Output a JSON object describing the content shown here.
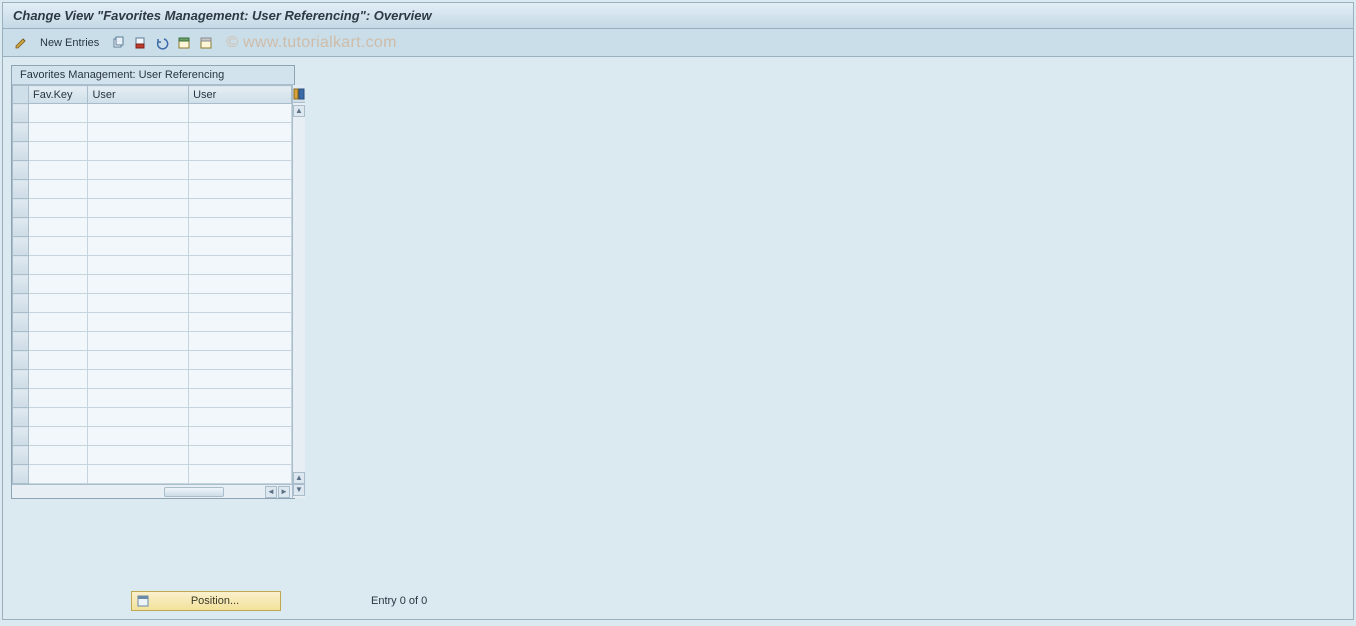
{
  "title": "Change View \"Favorites Management: User Referencing\": Overview",
  "toolbar": {
    "new_entries_label": "New Entries"
  },
  "watermark": "© www.tutorialkart.com",
  "table": {
    "caption": "Favorites Management: User Referencing",
    "columns": [
      "Fav.Key",
      "User",
      "User"
    ],
    "rows": [
      {
        "favkey": "",
        "user1": "",
        "user2": ""
      },
      {
        "favkey": "",
        "user1": "",
        "user2": ""
      },
      {
        "favkey": "",
        "user1": "",
        "user2": ""
      },
      {
        "favkey": "",
        "user1": "",
        "user2": ""
      },
      {
        "favkey": "",
        "user1": "",
        "user2": ""
      },
      {
        "favkey": "",
        "user1": "",
        "user2": ""
      },
      {
        "favkey": "",
        "user1": "",
        "user2": ""
      },
      {
        "favkey": "",
        "user1": "",
        "user2": ""
      },
      {
        "favkey": "",
        "user1": "",
        "user2": ""
      },
      {
        "favkey": "",
        "user1": "",
        "user2": ""
      },
      {
        "favkey": "",
        "user1": "",
        "user2": ""
      },
      {
        "favkey": "",
        "user1": "",
        "user2": ""
      },
      {
        "favkey": "",
        "user1": "",
        "user2": ""
      },
      {
        "favkey": "",
        "user1": "",
        "user2": ""
      },
      {
        "favkey": "",
        "user1": "",
        "user2": ""
      },
      {
        "favkey": "",
        "user1": "",
        "user2": ""
      },
      {
        "favkey": "",
        "user1": "",
        "user2": ""
      },
      {
        "favkey": "",
        "user1": "",
        "user2": ""
      },
      {
        "favkey": "",
        "user1": "",
        "user2": ""
      },
      {
        "favkey": "",
        "user1": "",
        "user2": ""
      }
    ]
  },
  "footer": {
    "position_label": "Position...",
    "entry_label": "Entry 0 of 0"
  },
  "icons": {
    "edit": "edit-icon",
    "copy": "copy-icon",
    "delete": "delete-icon",
    "undo": "undo-icon",
    "selectall": "select-all-icon",
    "deselect": "deselect-all-icon",
    "config": "table-settings-icon"
  }
}
